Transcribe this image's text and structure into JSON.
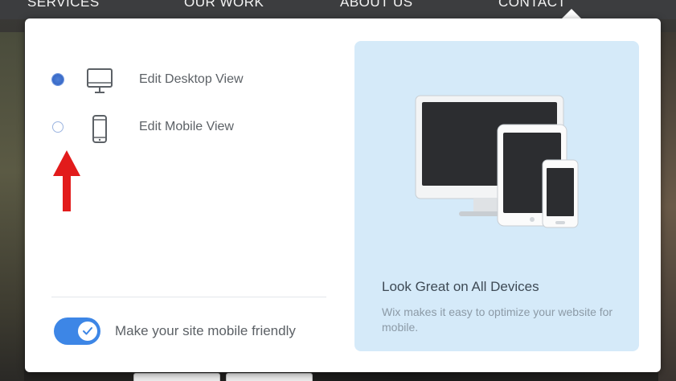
{
  "nav": {
    "items": [
      {
        "label": "SERVICES"
      },
      {
        "label": "OUR WORK"
      },
      {
        "label": "ABOUT US"
      },
      {
        "label": "CONTACT"
      }
    ]
  },
  "view_options": [
    {
      "label": "Edit Desktop View",
      "selected": true,
      "icon": "desktop-monitor-icon"
    },
    {
      "label": "Edit Mobile View",
      "selected": false,
      "icon": "mobile-phone-icon"
    }
  ],
  "mobile_friendly": {
    "label": "Make your site mobile friendly",
    "enabled": true
  },
  "info_panel": {
    "title": "Look Great on All Devices",
    "description": "Wix makes it easy to optimize your website for mobile."
  },
  "colors": {
    "accent": "#3d86e6",
    "panel_bg": "#d5eaf9",
    "annotation_arrow": "#e21b1b"
  }
}
